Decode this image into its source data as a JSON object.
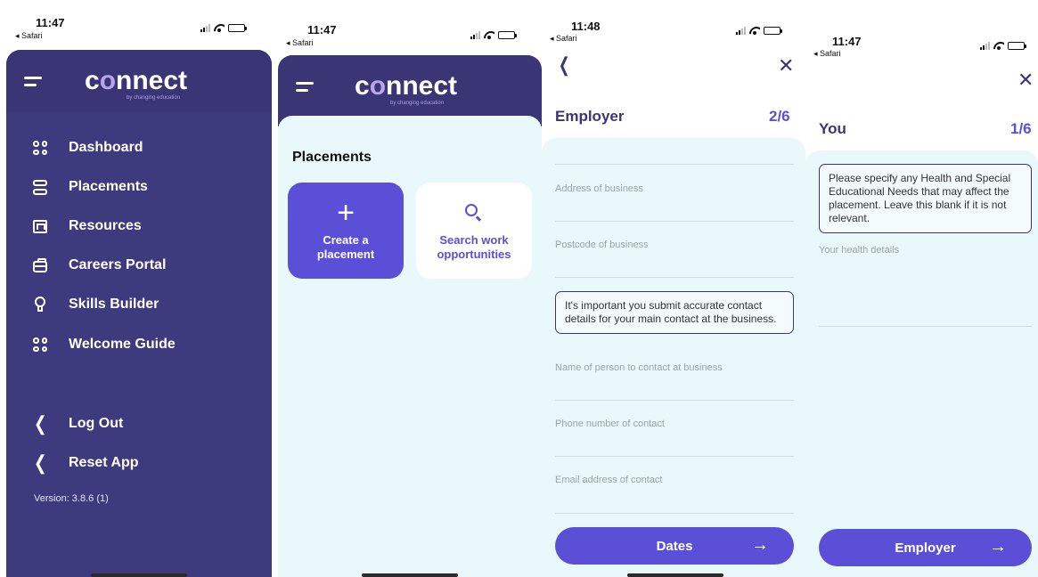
{
  "screen1": {
    "status": {
      "time": "11:47",
      "back": "◂ Safari"
    },
    "logo": {
      "text_pre": "c",
      "text_o": "o",
      "text_post": "nnect",
      "tagline": "by changing education"
    },
    "menu": [
      {
        "label": "Dashboard",
        "icon": "dashboard-grid-icon"
      },
      {
        "label": "Placements",
        "icon": "placements-list-icon"
      },
      {
        "label": "Resources",
        "icon": "resources-icon"
      },
      {
        "label": "Careers Portal",
        "icon": "briefcase-icon"
      },
      {
        "label": "Skills Builder",
        "icon": "award-icon"
      },
      {
        "label": "Welcome Guide",
        "icon": "welcome-grid-icon"
      }
    ],
    "actions": [
      {
        "label": "Log Out",
        "icon": "chevron-left-icon"
      },
      {
        "label": "Reset App",
        "icon": "chevron-left-icon"
      }
    ],
    "version": "Version: 3.8.6 (1)"
  },
  "screen2": {
    "status": {
      "time": "11:47",
      "back": "◂ Safari"
    },
    "section_title": "Placements",
    "tiles": [
      {
        "line1": "Create a",
        "line2": "placement",
        "icon": "plus-icon"
      },
      {
        "line1": "Search work",
        "line2": "opportunities",
        "icon": "search-icon"
      }
    ]
  },
  "screen3": {
    "status": {
      "time": "11:48",
      "back": "◂ Safari"
    },
    "title": "Employer",
    "step": "2/6",
    "fields": [
      "Address of business",
      "Postcode of business",
      "Name of person to contact at business",
      "Phone number of contact",
      "Email address of contact"
    ],
    "note": "It's important you submit accurate contact details for your main contact at the business.",
    "next_label": "Dates",
    "arrow": "→"
  },
  "screen4": {
    "status": {
      "time": "11:47",
      "back": "◂ Safari"
    },
    "title": "You",
    "step": "1/6",
    "note": "Please specify any Health and Special Educational Needs that may affect the placement. Leave this blank if it is not relevant.",
    "field_placeholder": "Your health details",
    "next_label": "Employer",
    "arrow": "→"
  },
  "colors": {
    "nav_dark": "#3a3575",
    "menu_bg": "#3e3a7e",
    "accent": "#5a4fd6",
    "form_bg": "#e9f8fb"
  }
}
